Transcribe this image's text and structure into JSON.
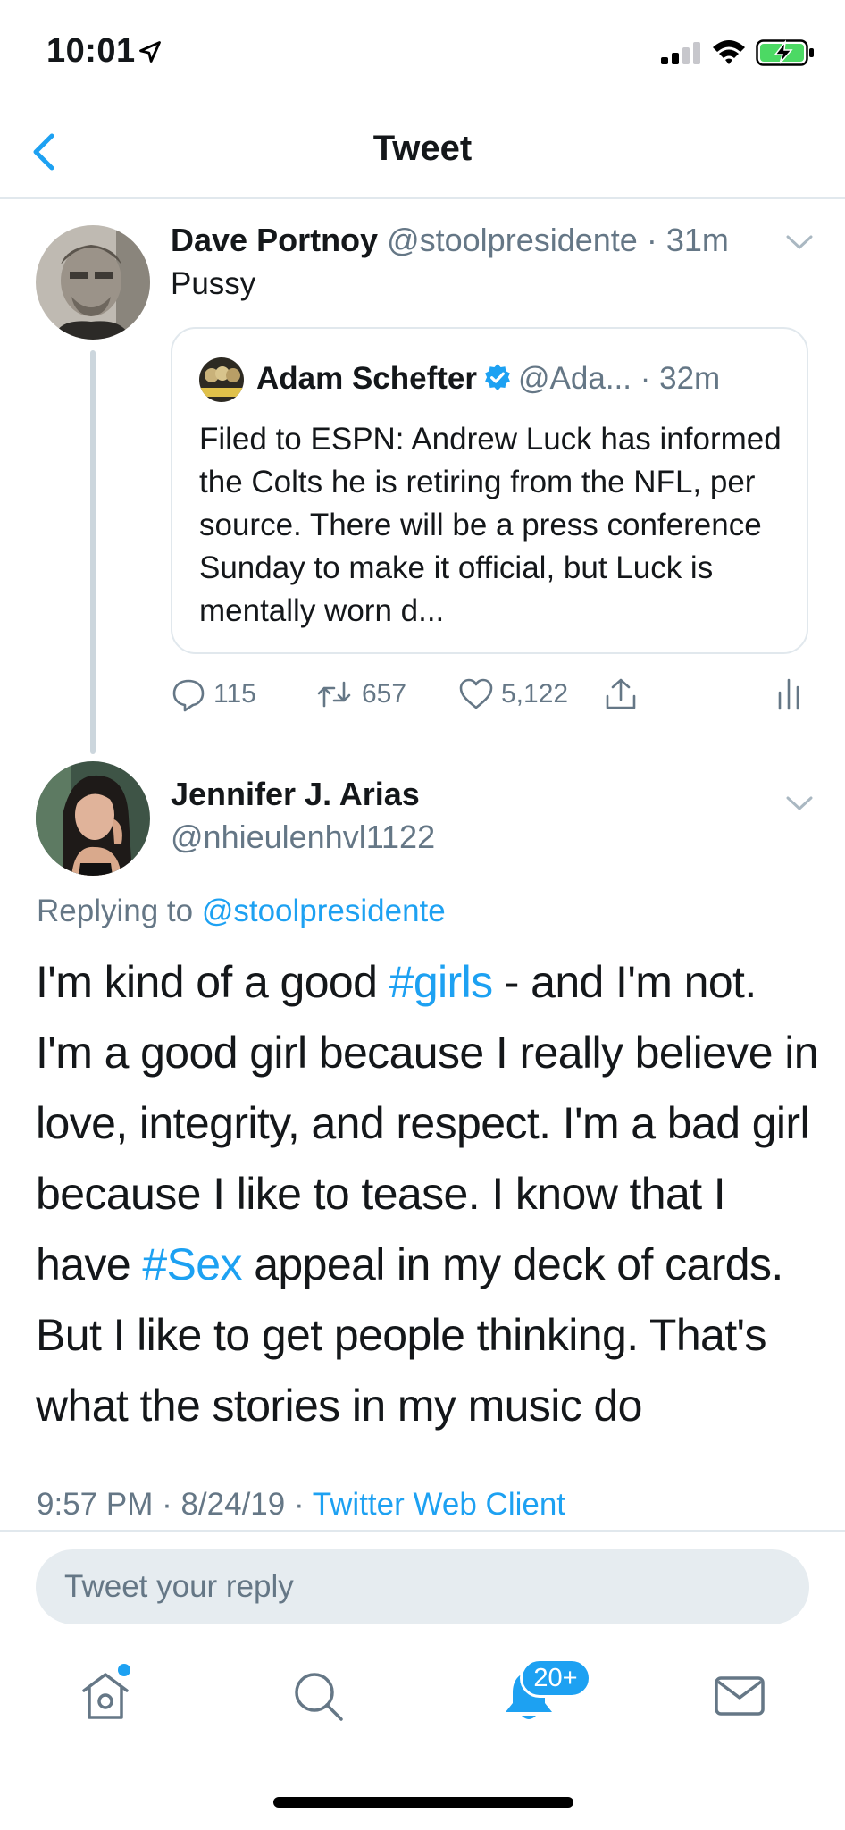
{
  "status_bar": {
    "time": "10:01"
  },
  "header": {
    "title": "Tweet"
  },
  "parent_tweet": {
    "name": "Dave Portnoy",
    "handle": "@stoolpresidente",
    "separator": " · ",
    "time": "31m",
    "text": "Pussy",
    "quoted": {
      "name": "Adam Schefter",
      "handle": "@Ada...",
      "separator": " · ",
      "time": "32m",
      "text": "Filed to ESPN: Andrew Luck has informed the Colts he is retiring from the NFL, per source. There will be a press conference Sunday to make it official, but Luck is mentally worn d..."
    },
    "actions": {
      "replies": "115",
      "retweets": "657",
      "likes": "5,122"
    }
  },
  "reply_tweet": {
    "name": "Jennifer J. Arias",
    "handle": "@nhieulenhvl1122",
    "replying_prefix": "Replying to ",
    "replying_to": "@stoolpresidente",
    "body": {
      "part1": "I'm kind of a good ",
      "hashtag1": "#girls",
      "part2": " - and I'm not. I'm a good girl because I really believe in love, integrity, and respect. I'm a bad girl because I like to tease. I know that I have ",
      "hashtag2": "#Sex",
      "part3": " appeal in my deck of cards. But I like to get people thinking. That's what the stories in my music do"
    },
    "meta": {
      "time_date": "9:57 PM · 8/24/19 · ",
      "source": "Twitter Web Client"
    }
  },
  "composer": {
    "placeholder": "Tweet your reply"
  },
  "tab_bar": {
    "notifications_badge": "20+"
  },
  "colors": {
    "accent": "#1da1f2",
    "secondary_text": "#657786",
    "divider": "#e1e8ed"
  },
  "icons": [
    "location-arrow-icon",
    "signal-icon",
    "wifi-icon",
    "battery-charging-icon",
    "back-chevron-icon",
    "chevron-down-icon",
    "verified-badge-icon",
    "reply-icon",
    "retweet-icon",
    "like-icon",
    "share-icon",
    "analytics-icon",
    "home-icon",
    "search-icon",
    "notifications-icon",
    "messages-icon"
  ]
}
